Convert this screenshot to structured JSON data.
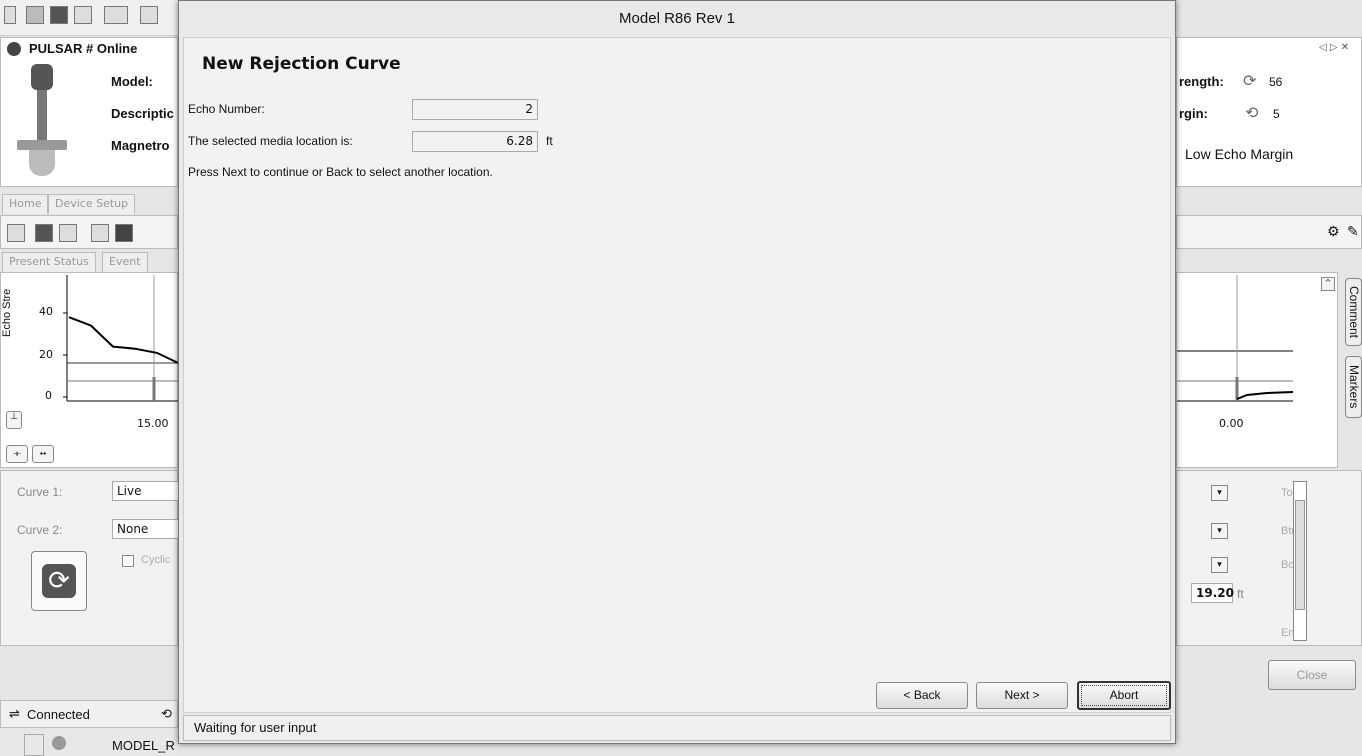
{
  "dialog": {
    "title": "Model R86 Rev 1",
    "heading": "New Rejection Curve",
    "echo_number_label": "Echo Number:",
    "echo_number_value": "2",
    "media_location_label": "The selected media location is:",
    "media_location_value": "6.28",
    "media_location_unit": "ft",
    "instruction": "Press Next to continue or Back to select another location.",
    "back_label": "< Back",
    "next_label": "Next >",
    "abort_label": "Abort",
    "status": "Waiting for user input"
  },
  "background": {
    "device_title": "PULSAR # Online ",
    "model_label": "Model:",
    "description_label": "Descriptic",
    "magnetron_label": "Magnetro",
    "tabs": [
      "Home",
      "Device Setup"
    ],
    "subtabs": [
      "Present Status",
      "Event "
    ],
    "y_axis_label": "Echo Stre",
    "y_ticks": [
      "40",
      "20",
      "0"
    ],
    "left_x_tick": "15.00",
    "right_x_tick": "0.00",
    "curve1_label": "Curve 1:",
    "curve1_value": "Live",
    "curve2_label": "Curve 2:",
    "curve2_value": "None",
    "cyclic_label": "Cyclic",
    "strength_label": "rength:",
    "strength_value": "56",
    "margin_label": "rgin:",
    "margin_value": "5",
    "low_echo_margin": "Low Echo Margin",
    "right_value": "19.20",
    "right_value_unit": "ft",
    "right_labels": [
      "To",
      "Btr",
      "Bo",
      "En"
    ],
    "close_label": "Close",
    "connected_label": "Connected",
    "model_footer": "MODEL_R",
    "side_tabs": [
      "Comment",
      "Markers"
    ],
    "nav_arrows": "◁ ▷ ✕"
  },
  "chart_data": [
    {
      "type": "line",
      "title": "",
      "ylabel": "Echo Stre",
      "ylim": [
        0,
        50
      ],
      "x_ticks": [
        "15.00"
      ],
      "y_ticks": [
        "40",
        "20",
        "0"
      ],
      "series": [
        {
          "x": [
            0,
            5,
            10,
            15,
            20,
            25
          ],
          "values": [
            38,
            34,
            24,
            23,
            21,
            16
          ]
        }
      ]
    }
  ]
}
